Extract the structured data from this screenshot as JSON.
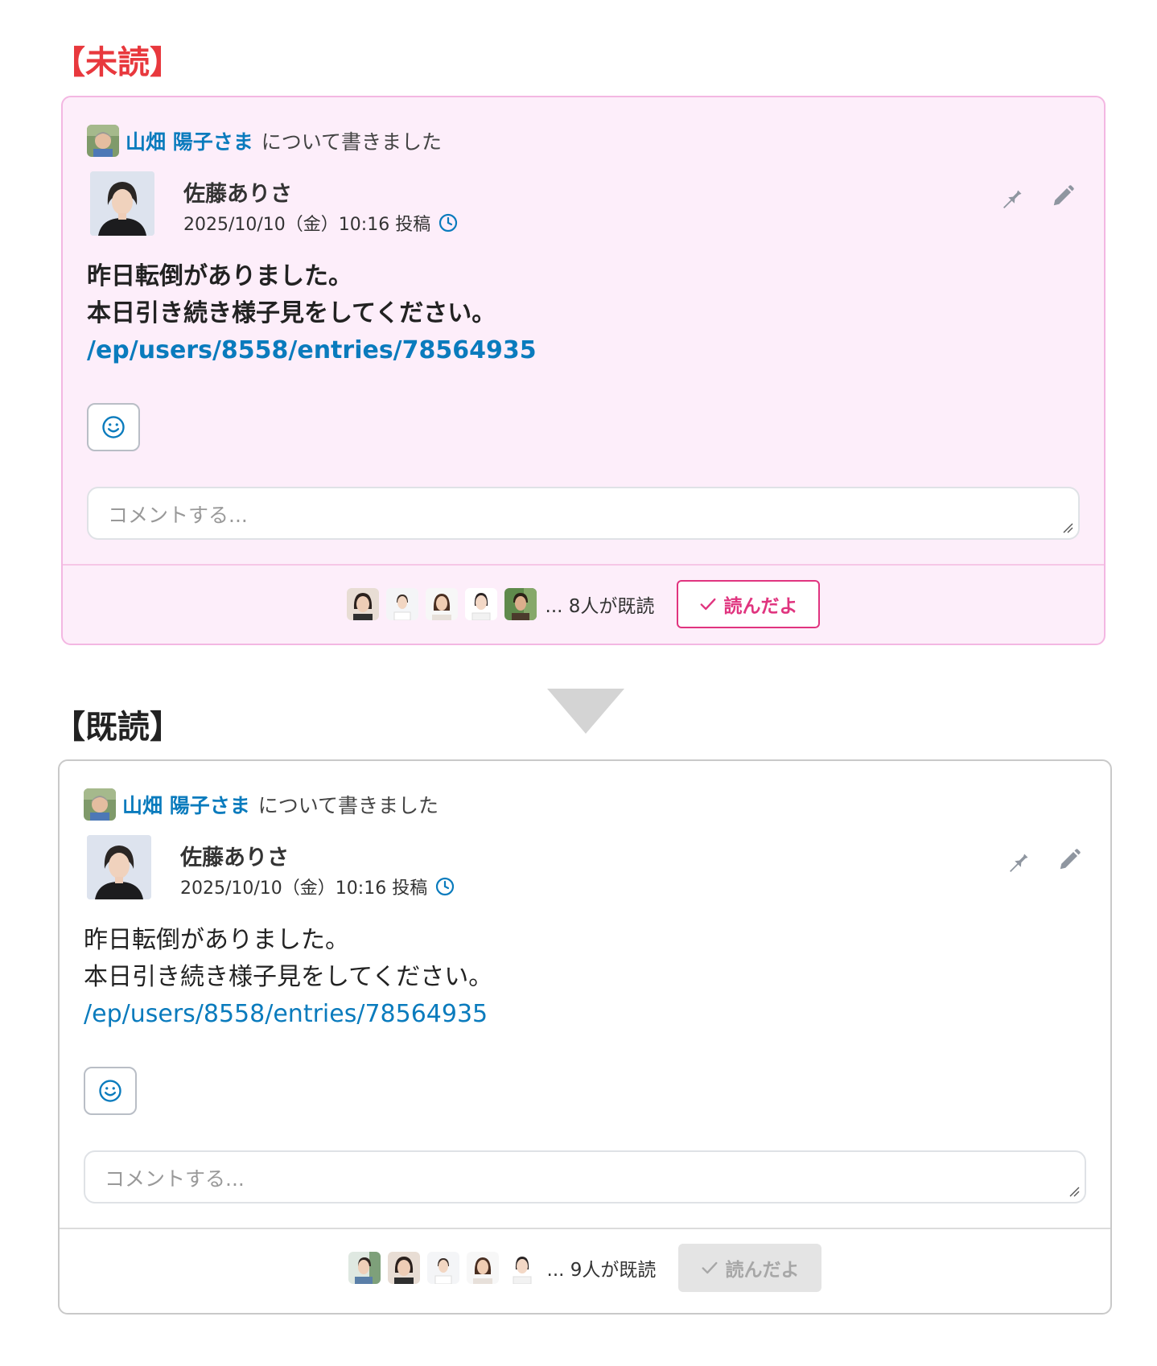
{
  "sections": {
    "unread": {
      "title": "【未読】"
    },
    "read": {
      "title": "【既読】"
    }
  },
  "post": {
    "about_name": "山畑 陽子さま",
    "about_suffix": "について書きました",
    "author": "佐藤ありさ",
    "posted_at": "2025/10/10（金）10:16 投稿",
    "body_line1": "昨日転倒がありました。",
    "body_line2": "本日引き続き様子見をしてください。",
    "link": "/ep/users/8558/entries/78564935",
    "comment_placeholder": "コメントする..."
  },
  "unread_card": {
    "read_count": "... 8人が既読",
    "read_button": "読んだよ"
  },
  "read_card": {
    "read_count": "... 9人が既読",
    "read_button": "読んだよ"
  },
  "colors": {
    "unread_title": "#e8383d",
    "link": "#0a7bbd",
    "unread_bg": "#fdeefa",
    "read_button_active": "#e0347f"
  },
  "icons": [
    "pin-icon",
    "pencil-icon",
    "clock-icon",
    "smiley-icon",
    "check-icon",
    "resize-handle-icon"
  ]
}
